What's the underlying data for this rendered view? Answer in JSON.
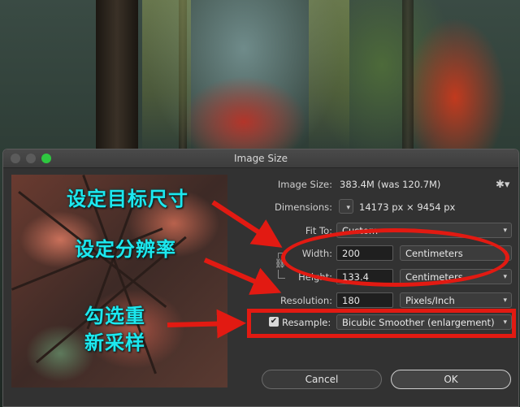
{
  "window": {
    "title": "Image Size"
  },
  "image_size": {
    "label": "Image Size:",
    "value": "383.4M (was 120.7M)"
  },
  "dimensions": {
    "label": "Dimensions:",
    "width": "14173 px",
    "separator": "×",
    "height": "9454 px"
  },
  "fit_to": {
    "label": "Fit To:",
    "value": "Custom"
  },
  "width": {
    "label": "Width:",
    "value": "200",
    "unit": "Centimeters"
  },
  "height": {
    "label": "Height:",
    "value": "133.4",
    "unit": "Centimeters"
  },
  "resolution": {
    "label": "Resolution:",
    "value": "180",
    "unit": "Pixels/Inch"
  },
  "resample": {
    "label": "Resample:",
    "checked": true,
    "method": "Bicubic Smoother (enlargement)"
  },
  "buttons": {
    "cancel": "Cancel",
    "ok": "OK"
  },
  "annotations": {
    "target_size": "设定目标尺寸",
    "resolution": "设定分辨率",
    "resample_line1": "勾选重",
    "resample_line2": "新采样"
  },
  "colors": {
    "annotation_text": "#1ce8ef",
    "annotation_mark": "#e21a12",
    "dialog_bg": "#323232"
  },
  "icons": {
    "gear": "gear-icon",
    "chain": "chain-link-icon",
    "dropdown": "chevron-down-icon",
    "check": "checkmark-icon"
  }
}
